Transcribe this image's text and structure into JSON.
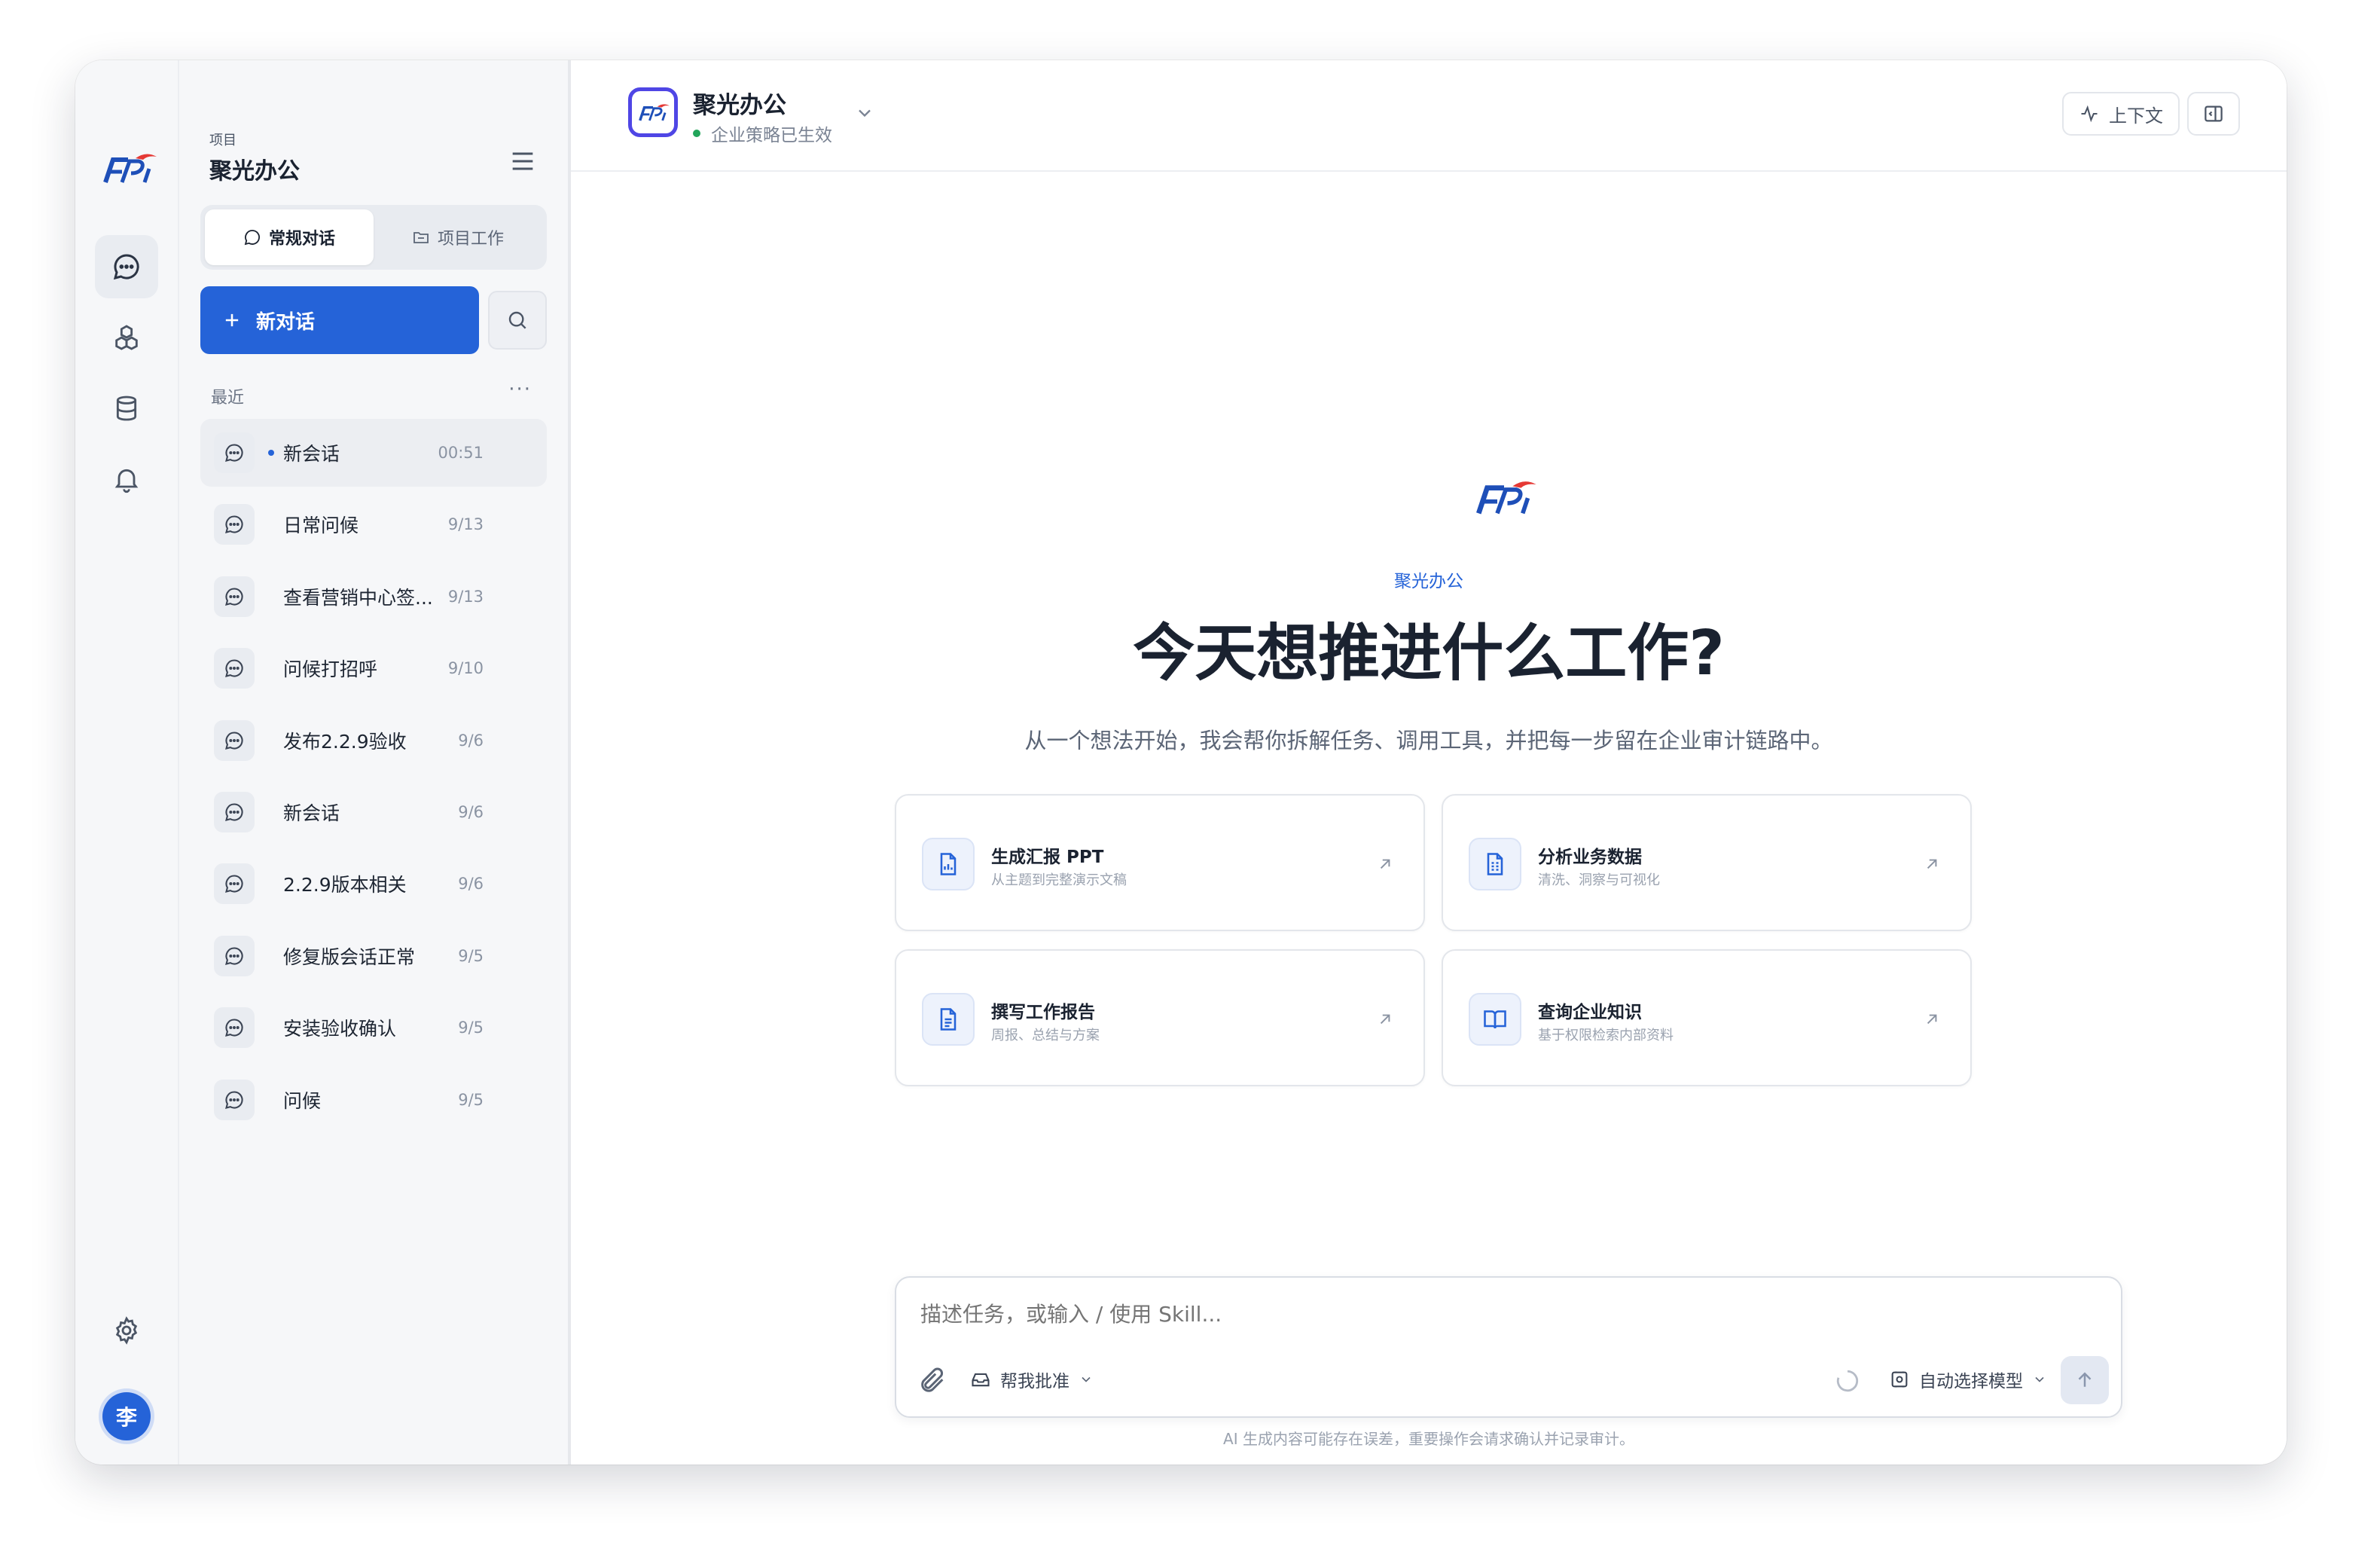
{
  "sidebar": {
    "project_label": "项目",
    "project_name": "聚光办公",
    "tabs": [
      {
        "label": "常规对话"
      },
      {
        "label": "项目工作"
      }
    ],
    "new_chat_label": "新对话",
    "recent_title": "最近",
    "recent_more": "···",
    "conversations": [
      {
        "title": "新会话",
        "time": "00:51"
      },
      {
        "title": "日常问候",
        "time": "9/13"
      },
      {
        "title": "查看营销中心签...",
        "time": "9/13"
      },
      {
        "title": "问候打招呼",
        "time": "9/10"
      },
      {
        "title": "发布2.2.9验收",
        "time": "9/6"
      },
      {
        "title": "新会话",
        "time": "9/6"
      },
      {
        "title": "2.2.9版本相关",
        "time": "9/6"
      },
      {
        "title": "修复版会话正常",
        "time": "9/5"
      },
      {
        "title": "安装验收确认",
        "time": "9/5"
      },
      {
        "title": "问候",
        "time": "9/5"
      }
    ]
  },
  "user": {
    "avatar_text": "李"
  },
  "header": {
    "app_title": "聚光办公",
    "status_text": "企业策略已生效",
    "context_label": "上下文"
  },
  "hero": {
    "brand": "聚光办公",
    "headline": "今天想推进什么工作?",
    "subline": "从一个想法开始，我会帮你拆解任务、调用工具，并把每一步留在企业审计链路中。"
  },
  "cards": [
    {
      "title": "生成汇报 PPT",
      "sub": "从主题到完整演示文稿",
      "icon": "presentation-chart-icon"
    },
    {
      "title": "分析业务数据",
      "sub": "清洗、洞察与可视化",
      "icon": "data-sheet-icon"
    },
    {
      "title": "撰写工作报告",
      "sub": "周报、总结与方案",
      "icon": "document-icon"
    },
    {
      "title": "查询企业知识",
      "sub": "基于权限检索内部资料",
      "icon": "book-icon"
    }
  ],
  "composer": {
    "placeholder": "描述任务，或输入 / 使用 Skill...",
    "approve_label": "帮我批准",
    "model_label": "自动选择模型"
  },
  "disclaimer": "AI 生成内容可能存在误差，重要操作会请求确认并记录审计。",
  "colors": {
    "accent": "#2563d8",
    "status_green": "#22a55a",
    "logo_red": "#e53935"
  }
}
